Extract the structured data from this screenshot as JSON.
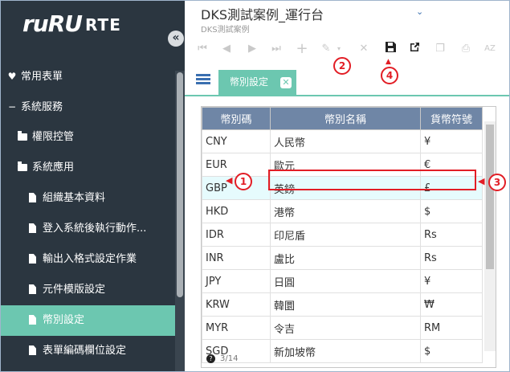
{
  "logo": {
    "part1": "ruRU",
    "part2": "RTE"
  },
  "sidebar": {
    "collapse_icon": "«",
    "items": [
      {
        "label": "常用表單",
        "icon": "heart-icon",
        "level": 0
      },
      {
        "label": "系統服務",
        "icon": "minus-icon",
        "level": 0
      },
      {
        "label": "權限控管",
        "icon": "folder-icon",
        "level": 1
      },
      {
        "label": "系統應用",
        "icon": "folder-icon",
        "level": 1
      },
      {
        "label": "組織基本資料",
        "icon": "document-icon",
        "level": 2
      },
      {
        "label": "登入系統後執行動作...",
        "icon": "document-icon",
        "level": 2
      },
      {
        "label": "輸出入格式設定作業",
        "icon": "document-icon",
        "level": 2
      },
      {
        "label": "元件模版設定",
        "icon": "document-icon",
        "level": 2
      },
      {
        "label": "幣別設定",
        "icon": "document-icon",
        "level": 2,
        "active": true
      },
      {
        "label": "表單編碼欄位設定",
        "icon": "document-icon",
        "level": 2
      }
    ]
  },
  "header": {
    "title": "DKS測試案例_運行台",
    "subtitle": "DKS測試案例"
  },
  "toolbar": {
    "first": "⏮",
    "prev": "◀",
    "next": "▶",
    "last": "⏭",
    "add": "+",
    "edit": "✎",
    "cancel": "✕",
    "save": "💾",
    "export": "⇱",
    "copy": "❐",
    "print": "⎙",
    "sort": "AZ"
  },
  "tab": {
    "label": "幣別設定",
    "close": "✕"
  },
  "grid": {
    "headers": [
      "幣別碼",
      "幣別名稱",
      "貨幣符號"
    ],
    "rows": [
      [
        "CNY",
        "人民幣",
        "¥"
      ],
      [
        "EUR",
        "歐元",
        "€"
      ],
      [
        "GBP",
        "英鎊",
        "£"
      ],
      [
        "HKD",
        "港幣",
        "$"
      ],
      [
        "IDR",
        "印尼盾",
        "Rs"
      ],
      [
        "INR",
        "盧比",
        "Rs"
      ],
      [
        "JPY",
        "日圓",
        "¥"
      ],
      [
        "KRW",
        "韓圜",
        "₩"
      ],
      [
        "MYR",
        "令吉",
        "RM"
      ],
      [
        "SGD",
        "新加坡幣",
        "$"
      ]
    ],
    "selected_row": 2,
    "pager": "3/14"
  },
  "annotations": {
    "m1": "1",
    "m2": "2",
    "m3": "3",
    "m4": "4"
  },
  "colors": {
    "sidebar_bg": "#2b3640",
    "accent": "#6cc7b0",
    "grid_header": "#6f86a6",
    "annotation": "#e21d25"
  }
}
